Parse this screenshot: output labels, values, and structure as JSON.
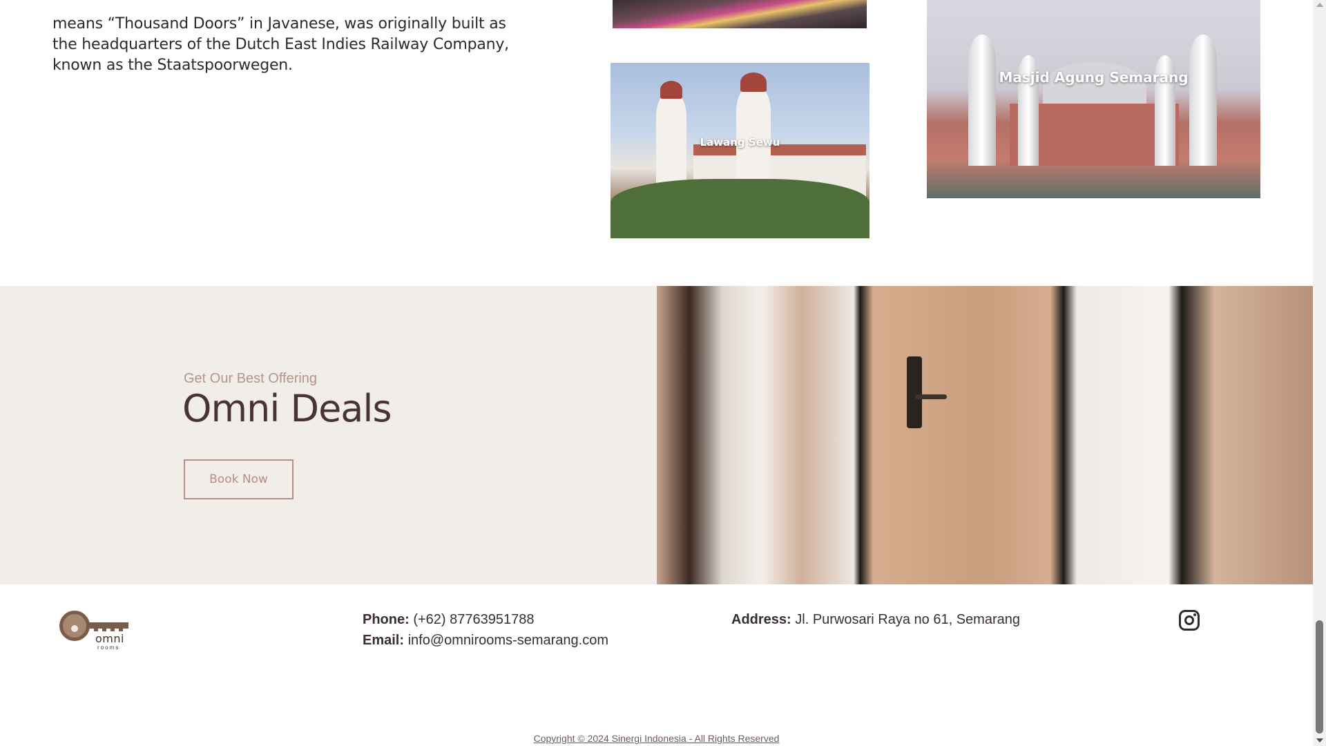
{
  "intro": {
    "text": "means “Thousand Doors” in Javanese, was originally built as the headquarters of the Dutch East Indies Railway Company, known as the Staatspoorwegen."
  },
  "gallery": {
    "lawang_caption": "Lawang Sewu",
    "masjid_caption": "Masjid Agung Semarang"
  },
  "deals": {
    "subtitle": "Get Our Best Offering",
    "title": "Omni Deals",
    "button": "Book Now"
  },
  "footer": {
    "logo_word": "omni",
    "logo_sub": "rooms",
    "phone_label": "Phone:",
    "phone": "(+62) 87763951788",
    "email_label": "Email:",
    "email": "info@omnirooms-semarang.com",
    "address_label": "Address:",
    "address": "Jl. Purwosari Raya no 61, Semarang",
    "copyright": "Copyright © 2024 Sinergi Indonesia - All Rights Reserved"
  },
  "icons": {
    "instagram": "instagram-icon",
    "key_logo": "key-icon"
  },
  "colors": {
    "accent": "#b88d84",
    "heading": "#4a3433",
    "deals_bg": "#f1ede8"
  }
}
